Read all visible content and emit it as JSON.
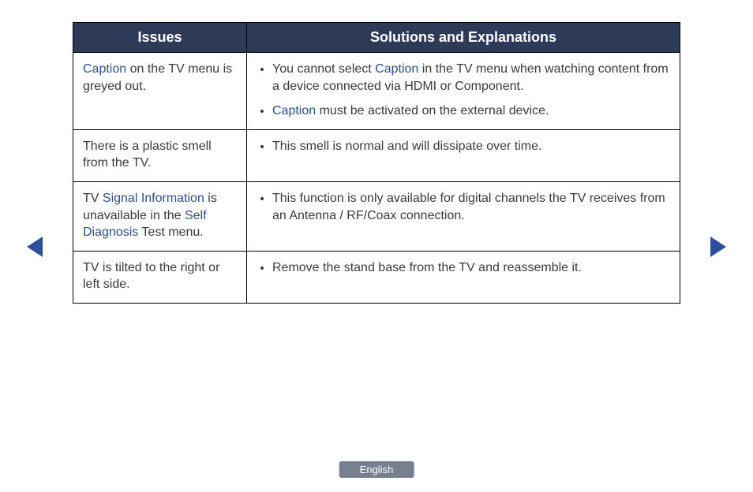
{
  "table": {
    "header": {
      "issues": "Issues",
      "solutions": "Solutions and Explanations"
    },
    "rows": [
      {
        "issue_parts": [
          {
            "text": "Caption",
            "kw": true
          },
          {
            "text": " on the TV menu is greyed out.",
            "kw": false
          }
        ],
        "solutions": [
          [
            {
              "text": "You cannot select ",
              "kw": false
            },
            {
              "text": "Caption",
              "kw": true
            },
            {
              "text": " in the TV menu when watching content from a device connected via HDMI or Component.",
              "kw": false
            }
          ],
          [
            {
              "text": "Caption",
              "kw": true
            },
            {
              "text": " must be activated on the external device.",
              "kw": false
            }
          ]
        ]
      },
      {
        "issue_parts": [
          {
            "text": "There is a plastic smell from the TV.",
            "kw": false
          }
        ],
        "solutions": [
          [
            {
              "text": "This smell is normal and will dissipate over time.",
              "kw": false
            }
          ]
        ]
      },
      {
        "issue_parts": [
          {
            "text": "TV ",
            "kw": false
          },
          {
            "text": "Signal Information",
            "kw": true
          },
          {
            "text": " is unavailable in the ",
            "kw": false
          },
          {
            "text": "Self Diagnosis",
            "kw": true
          },
          {
            "text": " Test menu.",
            "kw": false
          }
        ],
        "solutions": [
          [
            {
              "text": "This function is only available for digital channels the TV receives from an Antenna / RF/Coax connection.",
              "kw": false
            }
          ]
        ]
      },
      {
        "issue_parts": [
          {
            "text": "TV is tilted to the right or left side.",
            "kw": false
          }
        ],
        "solutions": [
          [
            {
              "text": "Remove the stand base from the TV and reassemble it.",
              "kw": false
            }
          ]
        ]
      }
    ]
  },
  "footer": {
    "language": "English"
  }
}
